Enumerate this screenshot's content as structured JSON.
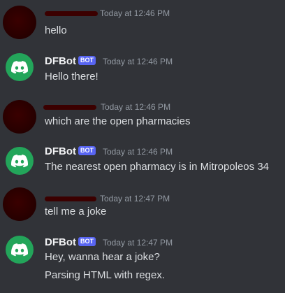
{
  "colors": {
    "background": "#313338",
    "text": "#dbdee1",
    "username": "#f2f3f5",
    "timestamp": "#949ba4",
    "bot_tag": "#5865f2",
    "bot_avatar": "#23a55a"
  },
  "messages": [
    {
      "author": "",
      "redacted": true,
      "timestamp": "Today at 12:46 PM",
      "lines": [
        "hello"
      ]
    },
    {
      "author": "DFBot",
      "bot_tag": "BOT",
      "avatar_icon": "discord-icon",
      "timestamp": "Today at 12:46 PM",
      "lines": [
        "Hello there!"
      ]
    },
    {
      "author": "",
      "redacted": true,
      "timestamp": "Today at 12:46 PM",
      "lines": [
        "which are the open pharmacies"
      ]
    },
    {
      "author": "DFBot",
      "bot_tag": "BOT",
      "avatar_icon": "discord-icon",
      "timestamp": "Today at 12:46 PM",
      "lines": [
        "The nearest open pharmacy is in Mitropoleos 34"
      ]
    },
    {
      "author": "",
      "redacted": true,
      "timestamp": "Today at 12:47 PM",
      "lines": [
        "tell me a joke"
      ]
    },
    {
      "author": "DFBot",
      "bot_tag": "BOT",
      "avatar_icon": "discord-icon",
      "timestamp": "Today at 12:47 PM",
      "lines": [
        "Hey, wanna hear a joke?",
        "Parsing HTML with regex."
      ]
    }
  ]
}
